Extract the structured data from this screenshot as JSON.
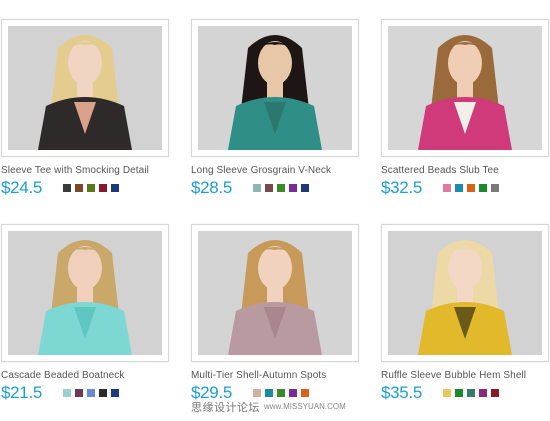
{
  "products": [
    {
      "name": "Sleeve Tee with Smocking Detail",
      "price": "$24.5",
      "swatches": [
        "#3a3a3a",
        "#7a4a2a",
        "#5a7a1a",
        "#8a1a2a",
        "#1a3a7a"
      ],
      "photo": {
        "bg": "#d2d2d2",
        "hair": "#e3cc8e",
        "skin": "#f0d5c2",
        "garment": "#2e2a2a",
        "accent": "#d9a08a"
      }
    },
    {
      "name": "Long Sleeve Grosgrain V-Neck",
      "price": "$28.5",
      "swatches": [
        "#8fb7b2",
        "#7a4a4a",
        "#3a8a2a",
        "#7a2a9a",
        "#1a3a7a"
      ],
      "photo": {
        "bg": "#d4d4d4",
        "hair": "#1e1614",
        "skin": "#e8c7a8",
        "garment": "#2f8e86",
        "accent": "#2a7870"
      }
    },
    {
      "name": "Scattered Beads Slub Tee",
      "price": "$32.5",
      "swatches": [
        "#e07aa0",
        "#1a8ab0",
        "#d8621a",
        "#1a8a2a",
        "#7a7a7a"
      ],
      "photo": {
        "bg": "#d6d6d6",
        "hair": "#9a6a3a",
        "skin": "#f0cdb5",
        "garment": "#d03a7a",
        "accent": "#f3efe8"
      }
    },
    {
      "name": "Cascade Beaded Boatneck",
      "price": "$21.5",
      "swatches": [
        "#9ad0d0",
        "#6a3a5a",
        "#6a8ad0",
        "#2a2a2a",
        "#1a3a7a"
      ],
      "photo": {
        "bg": "#d2d2d2",
        "hair": "#c9a86a",
        "skin": "#f0d0bd",
        "garment": "#7dd8d4",
        "accent": "#5fc6c2"
      }
    },
    {
      "name": "Multi-Tier Shell-Autumn Spots",
      "price": "$29.5",
      "swatches": [
        "#d2b0a0",
        "#1a8aa0",
        "#3a8a2a",
        "#7a2a9a",
        "#d8621a"
      ],
      "photo": {
        "bg": "#d4d4d4",
        "hair": "#c79a5a",
        "skin": "#f0d2bf",
        "garment": "#b89aa0",
        "accent": "#a8868e"
      }
    },
    {
      "name": "Ruffle Sleeve Bubble Hem Shell",
      "price": "$35.5",
      "swatches": [
        "#e8c85a",
        "#1a8a2a",
        "#3a7a6a",
        "#8a2a7a",
        "#8a1a2a"
      ],
      "photo": {
        "bg": "#d2d2d2",
        "hair": "#ecd9a6",
        "skin": "#f3d8c6",
        "garment": "#e3b92c",
        "accent": "#6a5a1a"
      }
    }
  ],
  "watermark": {
    "cn": "思缘设计论坛",
    "url": "www.MISSYUAN.COM"
  }
}
